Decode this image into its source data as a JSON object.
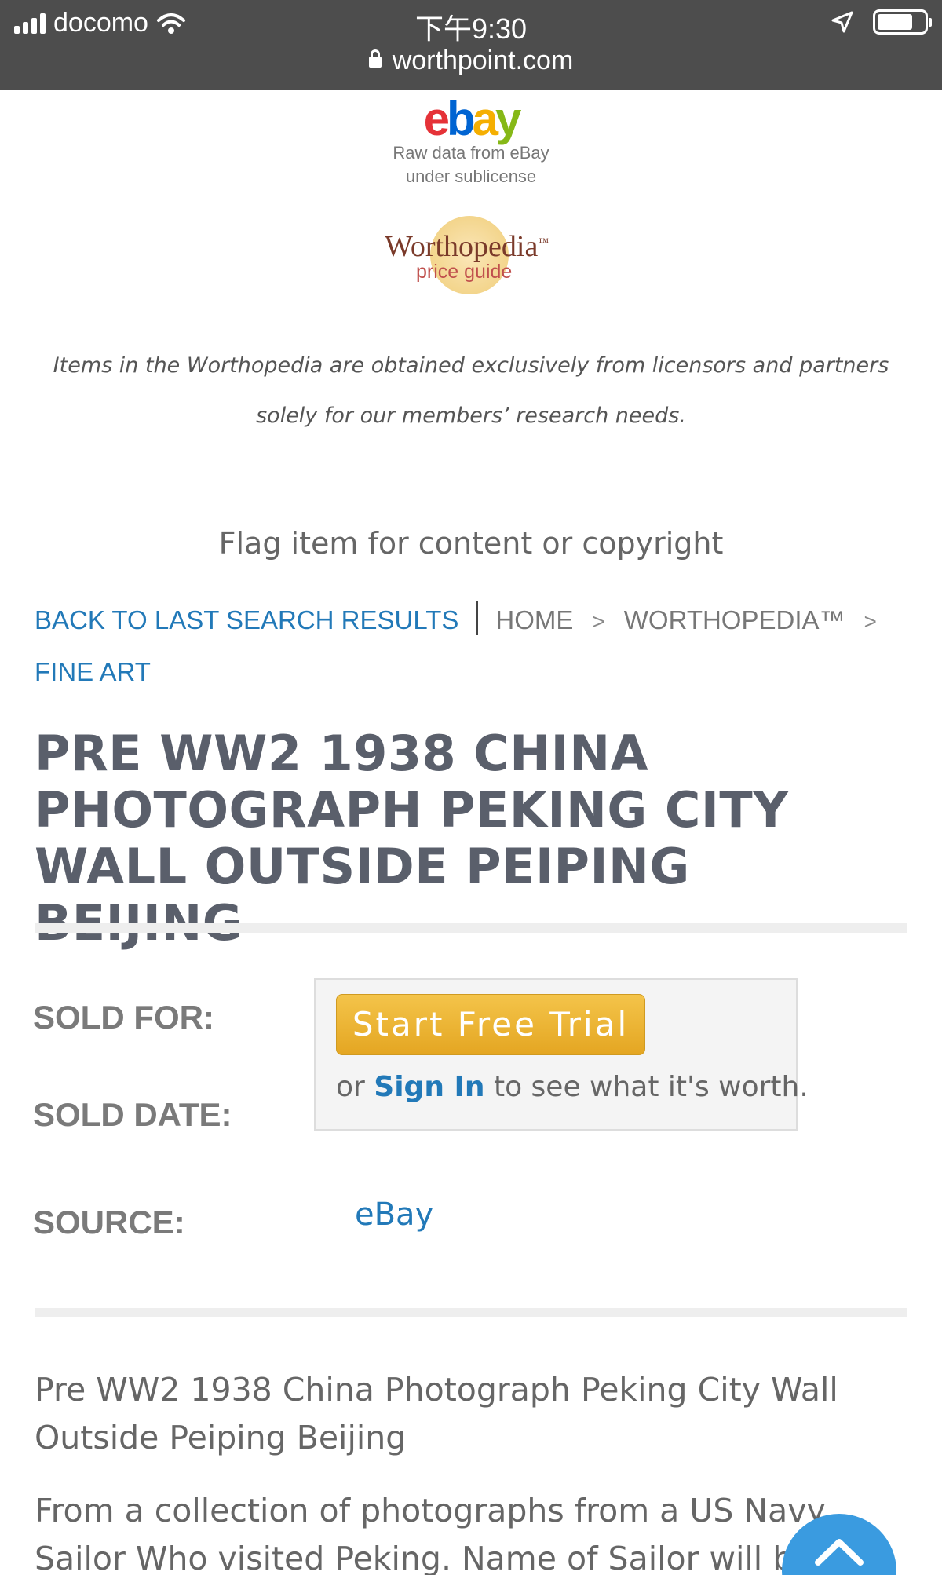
{
  "status_bar": {
    "carrier": "docomo",
    "time": "下午9:30",
    "url": "worthpoint.com"
  },
  "ebay_logo": {
    "letters": [
      "e",
      "b",
      "a",
      "y"
    ],
    "subtext_line1": "Raw data from eBay",
    "subtext_line2": "under sublicense"
  },
  "worthopedia_logo": {
    "name": "Worthopedia",
    "trademark": "™",
    "subtitle": "price guide"
  },
  "disclaimer": {
    "line1": "Items in the Worthopedia are obtained exclusively from licensors and partners",
    "line2": "solely for our members’ research needs."
  },
  "flag_link": "Flag item for content or copyright",
  "breadcrumb": {
    "back": "BACK TO LAST SEARCH RESULTS",
    "home": "HOME",
    "sep": ">",
    "worthopedia": "WORTHOPEDIA™",
    "category": "FINE ART"
  },
  "title": "PRE WW2 1938 CHINA PHOTOGRAPH PEKING CITY WALL OUTSIDE PEIPING BEIJING",
  "fields": {
    "sold_for_label": "SOLD FOR:",
    "sold_date_label": "SOLD DATE:",
    "source_label": "SOURCE:",
    "source_value": "eBay"
  },
  "trial": {
    "button_label": "Start Free Trial",
    "prefix": "or",
    "signin_label": "Sign In",
    "suffix": "to see what it's worth."
  },
  "description": {
    "summary": "Pre WW2 1938 China Photograph Peking City Wall Outside Peiping Beijing",
    "body": "From a collection of photographs from a US Navy Sailor Who visited Peking. Name of Sailor will be"
  },
  "colors": {
    "link": "#2279b8",
    "title": "#5a5f6b",
    "button": "#e8ad2a",
    "scroll_button": "#3a9be0"
  }
}
